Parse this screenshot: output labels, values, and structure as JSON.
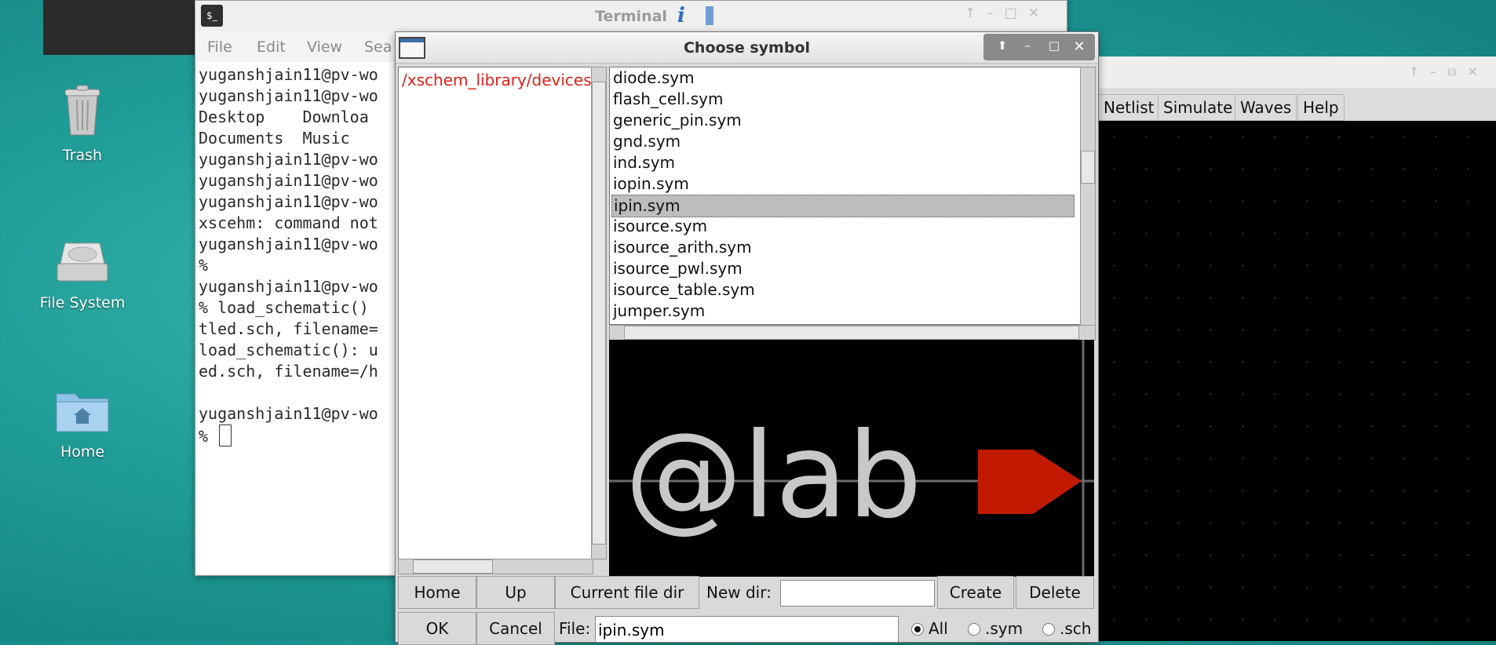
{
  "desktop": {
    "icons": [
      {
        "label": "Trash"
      },
      {
        "label": "File System"
      },
      {
        "label": "Home"
      }
    ]
  },
  "terminal": {
    "title": "Terminal",
    "menu": [
      "File",
      "Edit",
      "View",
      "Sea"
    ],
    "lines": [
      "yuganshjain11@pv-wo",
      "yuganshjain11@pv-wo",
      "Desktop    Downloa",
      "Documents  Music",
      "yuganshjain11@pv-wo",
      "yuganshjain11@pv-wo",
      "yuganshjain11@pv-wo",
      "xscehm: command not",
      "yuganshjain11@pv-wo",
      "%",
      "yuganshjain11@pv-wo",
      "% load_schematic() ",
      "tled.sch, filename=",
      "load_schematic(): u",
      "ed.sch, filename=/h",
      "",
      "yuganshjain11@pv-wo",
      "% "
    ]
  },
  "xschem": {
    "menu": [
      "Netlist",
      "Simulate",
      "Waves",
      "Help"
    ]
  },
  "dialog": {
    "title": "Choose symbol",
    "current_dir": "/xschem_library/devices",
    "files": [
      "diode.sym",
      "flash_cell.sym",
      "generic_pin.sym",
      "gnd.sym",
      "ind.sym",
      "iopin.sym",
      "ipin.sym",
      "isource.sym",
      "isource_arith.sym",
      "isource_pwl.sym",
      "isource_table.sym",
      "jumper.sym"
    ],
    "selected_index": 6,
    "preview_text": "@lab",
    "buttons": {
      "home": "Home",
      "up": "Up",
      "current_file_dir": "Current file dir",
      "create": "Create",
      "delete": "Delete",
      "ok": "OK",
      "cancel": "Cancel"
    },
    "new_dir_label": "New dir:",
    "new_dir_value": "",
    "file_label": "File:",
    "file_value": "ipin.sym",
    "filters": [
      {
        "label": "All",
        "checked": true
      },
      {
        "label": ".sym",
        "checked": false
      },
      {
        "label": ".sch",
        "checked": false
      }
    ]
  },
  "colors": {
    "desktop": "#1f9c97",
    "dir_highlight": "#e0201a",
    "pin_red": "#c21a00",
    "preview_text": "#c8c8c8"
  }
}
